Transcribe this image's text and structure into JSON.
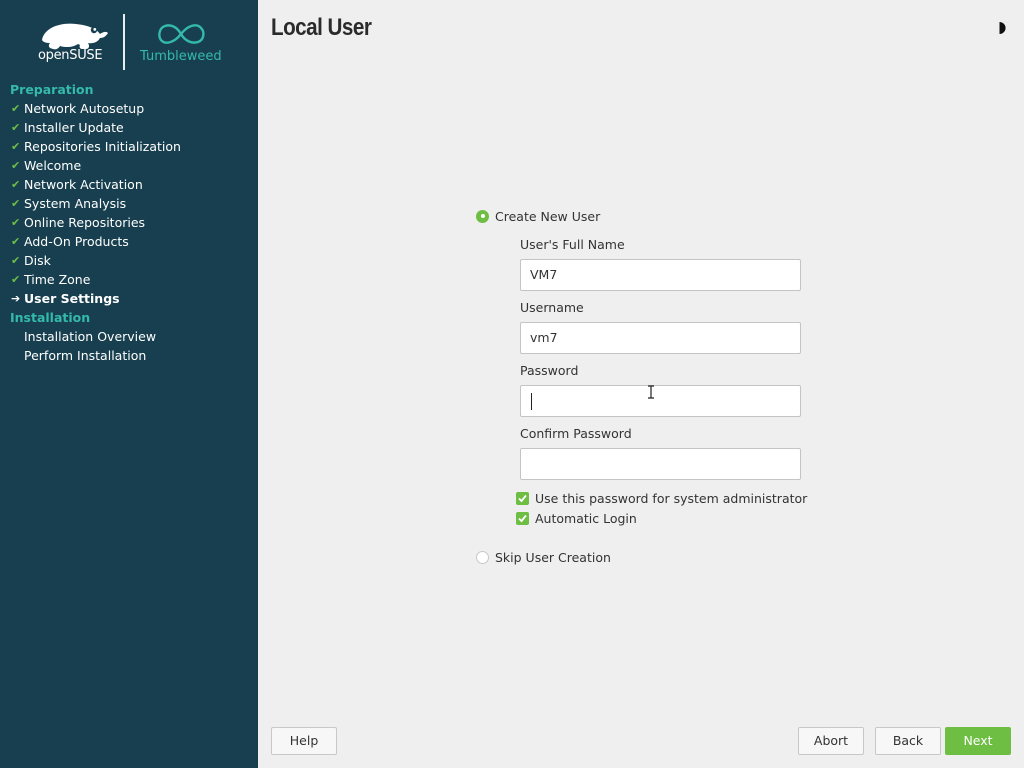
{
  "brand": {
    "suse_logo_text": "openSUSE",
    "product_name": "Tumbleweed"
  },
  "steps": {
    "groups": [
      {
        "title": "Preparation",
        "items": [
          {
            "label": "Network Autosetup",
            "state": "done"
          },
          {
            "label": "Installer Update",
            "state": "done"
          },
          {
            "label": "Repositories Initialization",
            "state": "done"
          },
          {
            "label": "Welcome",
            "state": "done"
          },
          {
            "label": "Network Activation",
            "state": "done"
          },
          {
            "label": "System Analysis",
            "state": "done"
          },
          {
            "label": "Online Repositories",
            "state": "done"
          },
          {
            "label": "Add-On Products",
            "state": "done"
          },
          {
            "label": "Disk",
            "state": "done"
          },
          {
            "label": "Time Zone",
            "state": "done"
          },
          {
            "label": "User Settings",
            "state": "current"
          }
        ]
      },
      {
        "title": "Installation",
        "items": [
          {
            "label": "Installation Overview",
            "state": "pending"
          },
          {
            "label": "Perform Installation",
            "state": "pending"
          }
        ]
      }
    ]
  },
  "page": {
    "title": "Local User"
  },
  "form": {
    "create_user_label": "Create New User",
    "create_user_selected": true,
    "full_name_label": "User's Full Name",
    "full_name_value": "VM7",
    "username_label": "Username",
    "username_value": "vm7",
    "password_label": "Password",
    "password_value": "",
    "confirm_password_label": "Confirm Password",
    "confirm_password_value": "",
    "use_for_admin_label": "Use this password for system administrator",
    "use_for_admin_checked": true,
    "auto_login_label": "Automatic Login",
    "auto_login_checked": true,
    "skip_user_label": "Skip User Creation",
    "skip_user_selected": false
  },
  "buttons": {
    "help": "Help",
    "abort": "Abort",
    "back": "Back",
    "next": "Next"
  },
  "colors": {
    "sidebar_bg": "#173f4f",
    "accent_green": "#6fbe44",
    "accent_teal": "#35b9ab",
    "main_bg": "#efefef"
  }
}
